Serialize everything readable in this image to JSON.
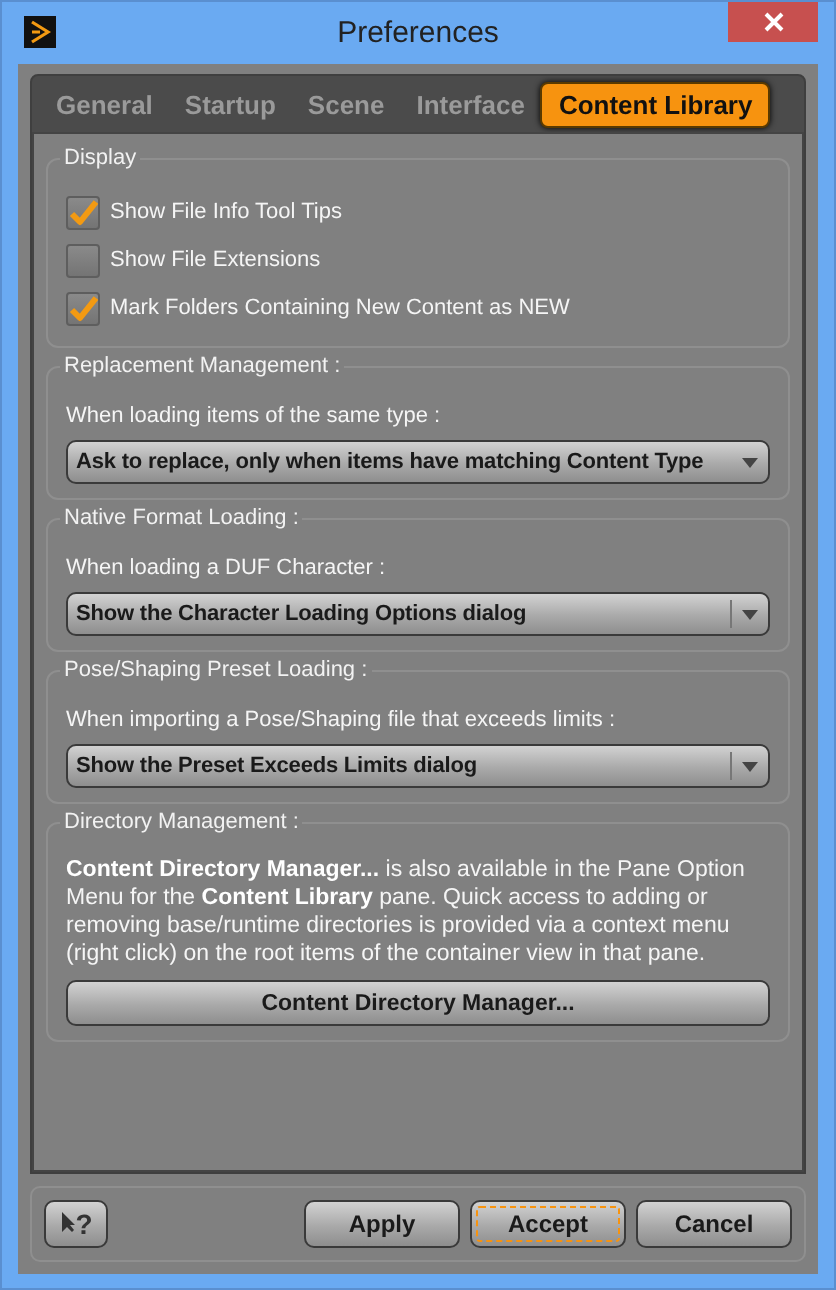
{
  "window": {
    "title": "Preferences"
  },
  "tabs": [
    {
      "label": "General",
      "selected": false
    },
    {
      "label": "Startup",
      "selected": false
    },
    {
      "label": "Scene",
      "selected": false
    },
    {
      "label": "Interface",
      "selected": false
    },
    {
      "label": "Content Library",
      "selected": true
    }
  ],
  "groups": [
    {
      "kind": "checks",
      "title": "Display",
      "items": [
        {
          "label": "Show File Info Tool Tips",
          "checked": true
        },
        {
          "label": "Show File Extensions",
          "checked": false
        },
        {
          "label": "Mark Folders Containing New Content as NEW",
          "checked": true
        }
      ]
    },
    {
      "kind": "combo",
      "title": "Replacement Management :",
      "prompt": "When loading items of the same type :",
      "value": "Ask to replace, only when items have matching Content Type"
    },
    {
      "kind": "combo",
      "title": "Native Format Loading :",
      "prompt": "When loading a DUF Character :",
      "value": "Show the Character Loading Options dialog"
    },
    {
      "kind": "combo",
      "title": "Pose/Shaping Preset Loading :",
      "prompt": "When importing a Pose/Shaping file that exceeds limits :",
      "value": "Show the Preset Exceeds Limits dialog"
    },
    {
      "kind": "info",
      "title": "Directory Management :",
      "text": "**Content Directory Manager...** is also available in the Pane Option Menu for the **Content Library** pane. Quick access to adding or removing base/runtime directories is provided via a context menu (right click) on the root items of the container view in that pane.",
      "button": "Content Directory Manager..."
    }
  ],
  "footer": {
    "help": "?",
    "buttons": [
      {
        "label": "Apply",
        "focused": false
      },
      {
        "label": "Accept",
        "focused": true
      },
      {
        "label": "Cancel",
        "focused": false
      }
    ]
  }
}
